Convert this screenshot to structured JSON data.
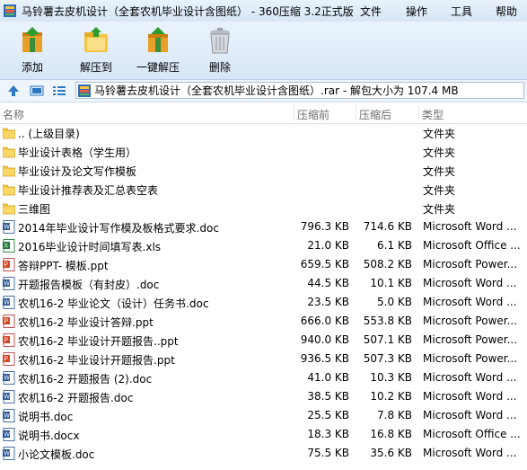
{
  "titlebar": {
    "title": "马铃薯去皮机设计（全套农机毕业设计含图纸） - 360压缩 3.2正式版",
    "menus": [
      "文件",
      "操作",
      "工具",
      "帮助"
    ]
  },
  "toolbar": {
    "add_label": "添加",
    "extract_to_label": "解压到",
    "one_click_label": "一键解压",
    "delete_label": "删除"
  },
  "address": {
    "path": "马铃薯去皮机设计（全套农机毕业设计含图纸）.rar - 解包大小为 107.4 MB"
  },
  "columns": {
    "name": "名称",
    "compressed": "压缩前",
    "original": "压缩后",
    "type": "类型"
  },
  "rows": [
    {
      "icon": "folder-icon",
      "name": ".. (上级目录)",
      "compressed": "",
      "original": "",
      "type": "文件夹"
    },
    {
      "icon": "folder-icon",
      "name": "毕业设计表格（学生用）",
      "compressed": "",
      "original": "",
      "type": "文件夹"
    },
    {
      "icon": "folder-icon",
      "name": "毕业设计及论文写作模板",
      "compressed": "",
      "original": "",
      "type": "文件夹"
    },
    {
      "icon": "folder-icon",
      "name": "毕业设计推荐表及汇总表空表",
      "compressed": "",
      "original": "",
      "type": "文件夹"
    },
    {
      "icon": "folder-icon",
      "name": "三维图",
      "compressed": "",
      "original": "",
      "type": "文件夹"
    },
    {
      "icon": "word-doc-icon",
      "name": "2014年毕业设计写作模及板格式要求.doc",
      "compressed": "796.3 KB",
      "original": "714.6 KB",
      "type": "Microsoft Word ..."
    },
    {
      "icon": "excel-doc-icon",
      "name": "2016毕业设计时间填写表.xls",
      "compressed": "21.0 KB",
      "original": "6.1 KB",
      "type": "Microsoft Office ..."
    },
    {
      "icon": "ppt-doc-icon",
      "name": "答辩PPT- 模板.ppt",
      "compressed": "659.5 KB",
      "original": "508.2 KB",
      "type": "Microsoft Power..."
    },
    {
      "icon": "word-doc-icon",
      "name": "开题报告模板（有封皮）.doc",
      "compressed": "44.5 KB",
      "original": "10.1 KB",
      "type": "Microsoft Word ..."
    },
    {
      "icon": "word-doc-icon",
      "name": "农机16-2  毕业论文（设计）任务书.doc",
      "compressed": "23.5 KB",
      "original": "5.0 KB",
      "type": "Microsoft Word ..."
    },
    {
      "icon": "ppt-doc-icon",
      "name": "农机16-2  毕业设计答辩.ppt",
      "compressed": "666.0 KB",
      "original": "553.8 KB",
      "type": "Microsoft Power..."
    },
    {
      "icon": "ppt-doc-icon",
      "name": "农机16-2  毕业设计开题报告..ppt",
      "compressed": "940.0 KB",
      "original": "507.1 KB",
      "type": "Microsoft Power..."
    },
    {
      "icon": "ppt-doc-icon",
      "name": "农机16-2  毕业设计开题报告.ppt",
      "compressed": "936.5 KB",
      "original": "507.3 KB",
      "type": "Microsoft Power..."
    },
    {
      "icon": "word-doc-icon",
      "name": "农机16-2  开题报告 (2).doc",
      "compressed": "41.0 KB",
      "original": "10.3 KB",
      "type": "Microsoft Word ..."
    },
    {
      "icon": "word-doc-icon",
      "name": "农机16-2  开题报告.doc",
      "compressed": "38.5 KB",
      "original": "10.2 KB",
      "type": "Microsoft Word ..."
    },
    {
      "icon": "word-doc-icon",
      "name": "说明书.doc",
      "compressed": "25.5 KB",
      "original": "7.8 KB",
      "type": "Microsoft Word ..."
    },
    {
      "icon": "word-docx-icon",
      "name": "说明书.docx",
      "compressed": "18.3 KB",
      "original": "16.8 KB",
      "type": "Microsoft Office ..."
    },
    {
      "icon": "word-doc-icon",
      "name": "小论文模板.doc",
      "compressed": "75.5 KB",
      "original": "35.6 KB",
      "type": "Microsoft Word ..."
    }
  ]
}
